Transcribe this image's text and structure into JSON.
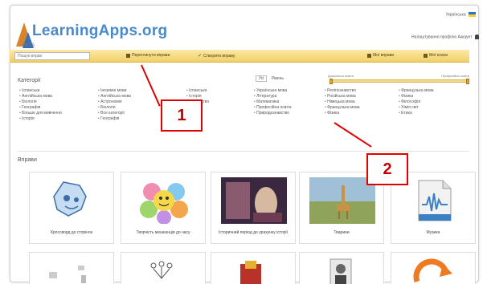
{
  "header": {
    "logo_text": "LearningApps.org",
    "logo_sub": "BETA",
    "language": "Українська",
    "user_line": "Налаштування профілю Аккаунт"
  },
  "toolbar": {
    "search_placeholder": "Пошук вправ",
    "browse_label": "Переглянути вправи",
    "create_label": "Створити вправу",
    "my_apps_label": "Мої вправи",
    "my_classes_label": "Мої класи"
  },
  "categories": {
    "title": "Категорії",
    "col1": [
      "Іспанська",
      "Англійська мова",
      "Біологія",
      "Географія",
      "Більше для вивчення",
      "Історія"
    ],
    "col2": [
      "Іноземні мови",
      "Англійська мова",
      "Астрономія",
      "Біологія",
      "Все категорії",
      "Географія"
    ],
    "col3": [
      "Іспанська",
      "Історія",
      "Мистецтво",
      "Музика"
    ],
    "col4": [
      "Українська мова",
      "Література",
      "Математика",
      "Професійна освіта",
      "Природознавство"
    ],
    "col5": [
      "Релігієзнавство",
      "Російська мова",
      "Німецька мова",
      "Французька мова",
      "Фізика"
    ],
    "col6": [
      "Французька мова",
      "Фізика",
      "Філософія",
      "Хімія світ",
      "Етика"
    ]
  },
  "levels": {
    "level_label": "Рівень",
    "all_label": "Усі",
    "left_label": "Дошкільна освіта",
    "right_label": "Професійна освіта"
  },
  "apps": {
    "title": "Вправи",
    "cards": [
      {
        "caption": "Кроссворд до сторінок"
      },
      {
        "caption": "Творчість мешканців до часу"
      },
      {
        "caption": "Історичний період до урахунку історії"
      },
      {
        "caption": "Тварини"
      },
      {
        "caption": "Музика"
      }
    ]
  },
  "annotations": {
    "label1": "1",
    "label2": "2"
  }
}
